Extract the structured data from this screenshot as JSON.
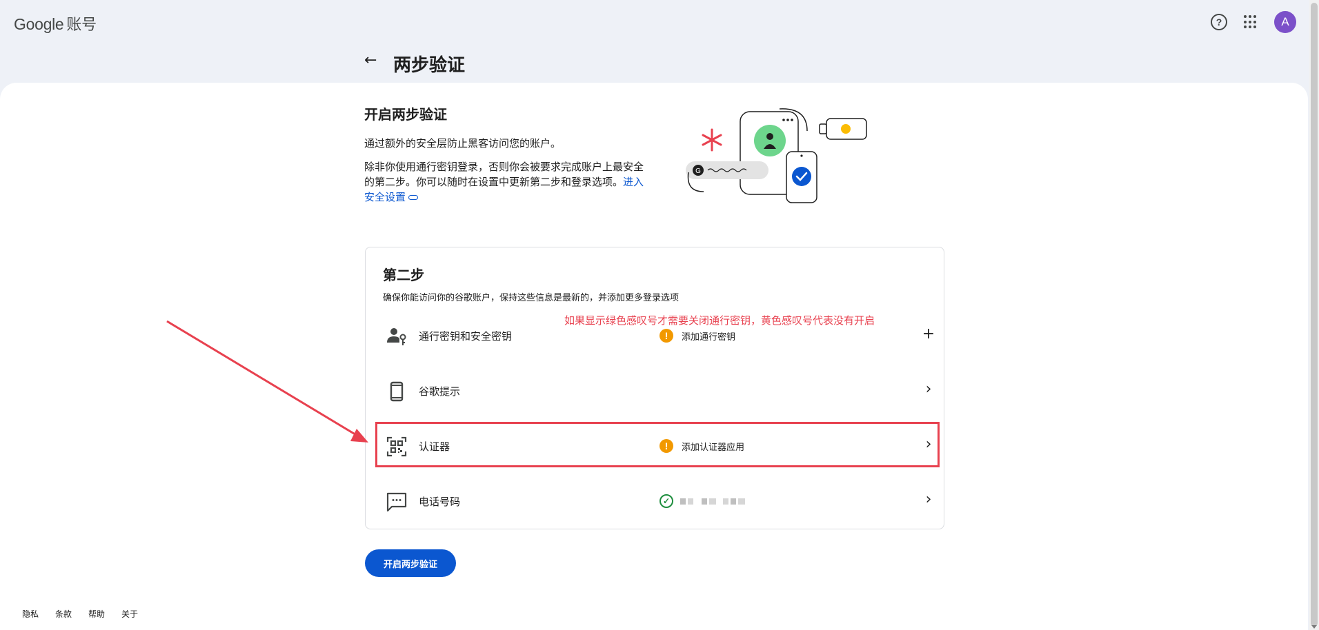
{
  "topbar": {
    "logo_brand": "Google",
    "logo_product": "账号",
    "help_glyph": "?",
    "avatar_initial": "A"
  },
  "header": {
    "back_glyph": "←",
    "title": "两步验证"
  },
  "intro": {
    "heading": "开启两步验证",
    "para1": "通过额外的安全层防止黑客访问您的账户。",
    "para2": "除非你使用通行密钥登录，否则你会被要求完成账户上最安全的第二步。你可以随时在设置中更新第二步和登录选项。",
    "link_text": "进入安全设置"
  },
  "card": {
    "title": "第二步",
    "subtitle": "确保你能访问你的谷歌账户，保持这些信息是最新的，并添加更多登录选项",
    "annotation": "如果显示绿色感叹号才需要关闭通行密钥，黄色感叹号代表没有开启",
    "rows": [
      {
        "label": "通行密钥和安全密钥",
        "icon": "person-key-icon",
        "status": "warn",
        "status_glyph": "!",
        "status_text": "添加通行密钥",
        "action_glyph": "+"
      },
      {
        "label": "谷歌提示",
        "icon": "phone-icon",
        "status": "none",
        "status_glyph": "",
        "status_text": "",
        "action_glyph": "›"
      },
      {
        "label": "认证器",
        "icon": "qr-code-icon",
        "status": "warn",
        "status_glyph": "!",
        "status_text": "添加认证器应用",
        "action_glyph": "›"
      },
      {
        "label": "电话号码",
        "icon": "message-icon",
        "status": "ok",
        "status_glyph": "✓",
        "status_text": "",
        "action_glyph": "›"
      }
    ]
  },
  "primary_button": "开启两步验证",
  "footer": [
    "隐私",
    "条款",
    "帮助",
    "关于"
  ],
  "colors": {
    "accent": "#0b57d0",
    "warn": "#f29900",
    "ok": "#1e8e3e",
    "annotation_red": "#e8414f",
    "page_bg": "#eef1f7"
  }
}
